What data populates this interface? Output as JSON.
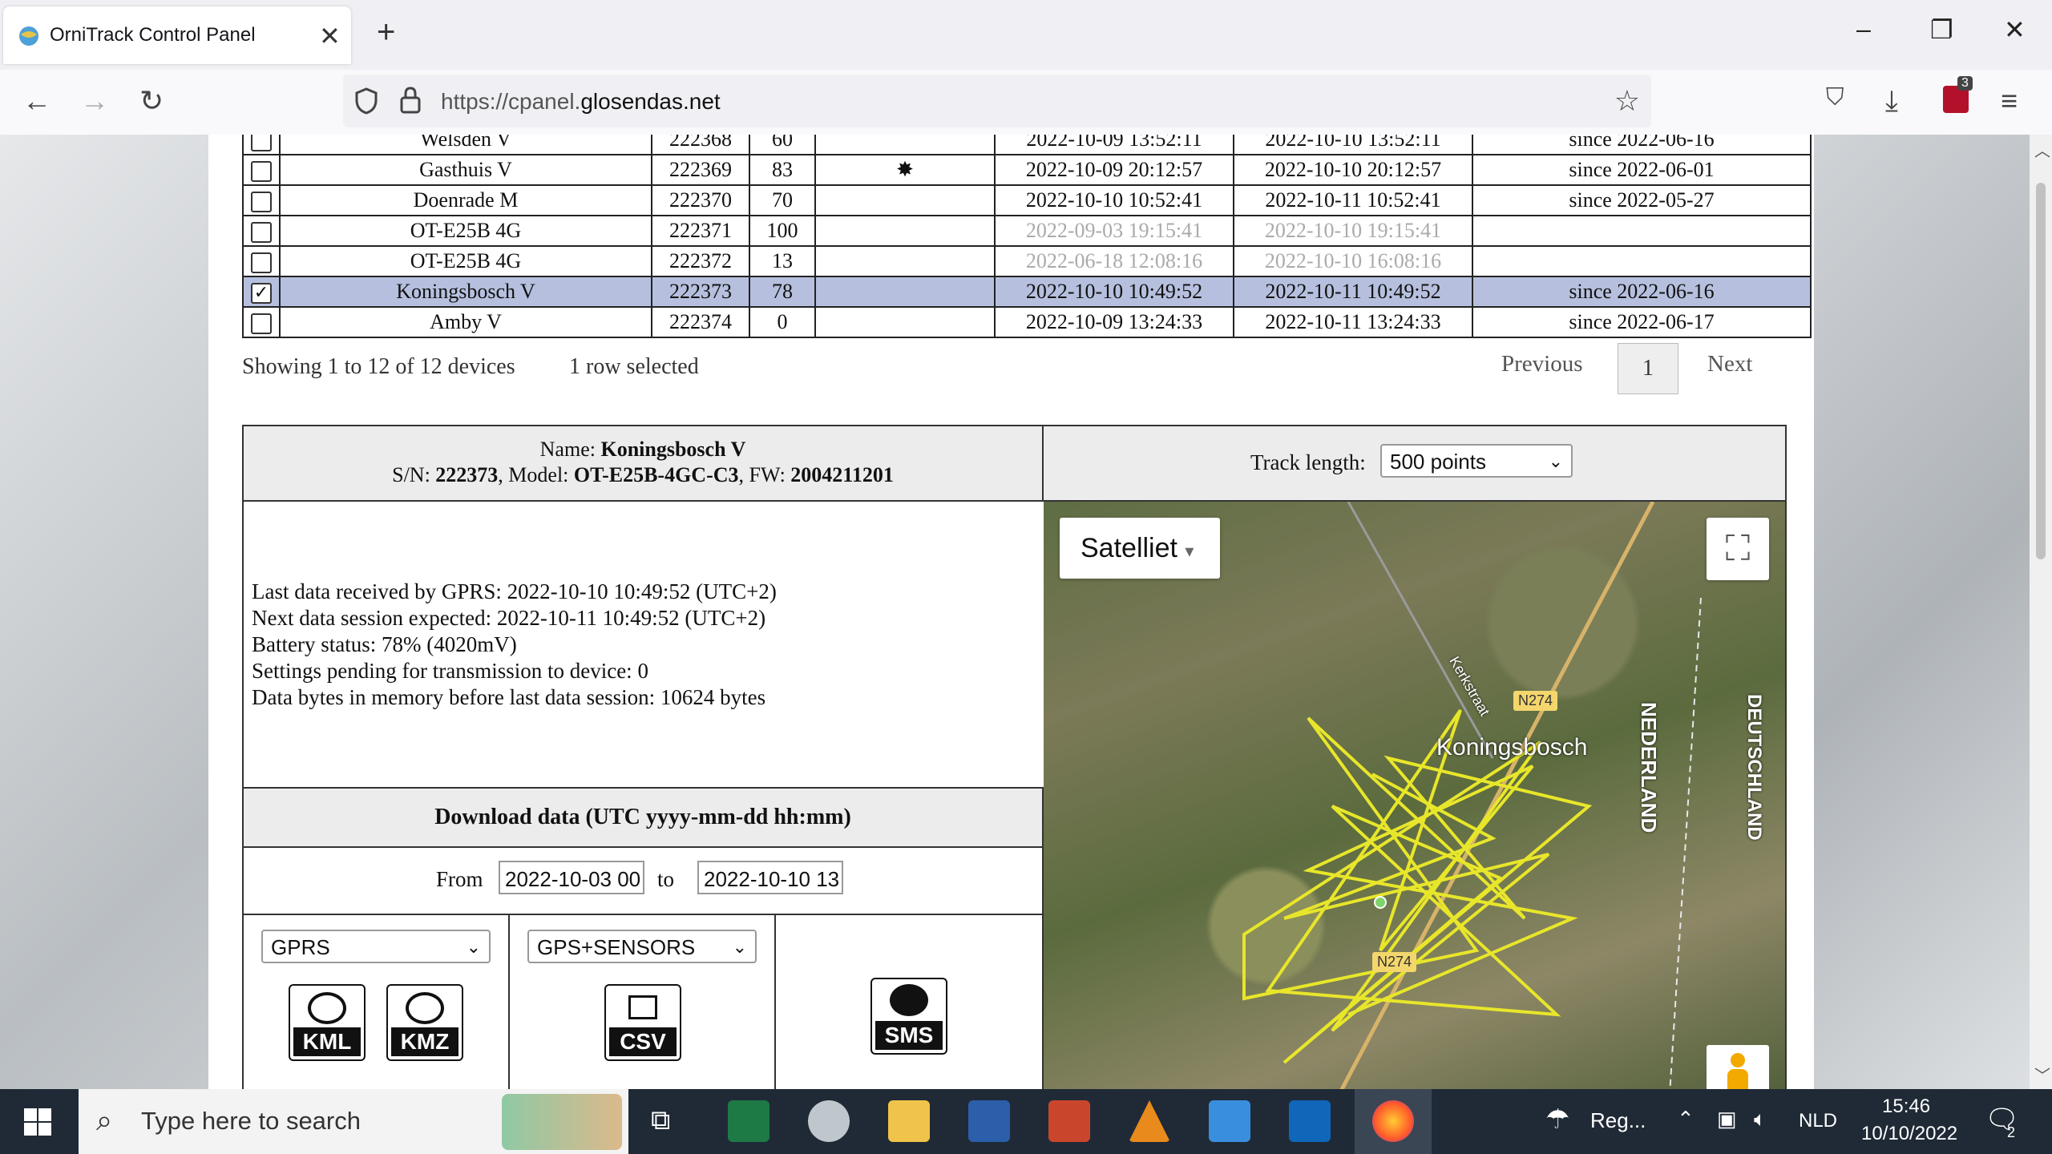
{
  "browser": {
    "tab_title": "OrniTrack Control Panel",
    "url_prefix": "https://cpanel.",
    "url_domain": "glosendas.net",
    "extension_badge": "3"
  },
  "devices_table": {
    "rows": [
      {
        "checked": false,
        "name": "Welsden V",
        "sn": "222368",
        "battery": "60",
        "flag": "",
        "last": "2022-10-09 13:52:11",
        "next": "2022-10-10 13:52:11",
        "since": "since 2022-06-16",
        "faded": false,
        "selected": false
      },
      {
        "checked": false,
        "name": "Gasthuis V",
        "sn": "222369",
        "battery": "83",
        "flag": "✸",
        "last": "2022-10-09 20:12:57",
        "next": "2022-10-10 20:12:57",
        "since": "since 2022-06-01",
        "faded": false,
        "selected": false
      },
      {
        "checked": false,
        "name": "Doenrade M",
        "sn": "222370",
        "battery": "70",
        "flag": "",
        "last": "2022-10-10 10:52:41",
        "next": "2022-10-11 10:52:41",
        "since": "since 2022-05-27",
        "faded": false,
        "selected": false
      },
      {
        "checked": false,
        "name": "OT-E25B 4G",
        "sn": "222371",
        "battery": "100",
        "flag": "",
        "last": "2022-09-03 19:15:41",
        "next": "2022-10-10 19:15:41",
        "since": "",
        "faded": true,
        "selected": false
      },
      {
        "checked": false,
        "name": "OT-E25B 4G",
        "sn": "222372",
        "battery": "13",
        "flag": "",
        "last": "2022-06-18 12:08:16",
        "next": "2022-10-10 16:08:16",
        "since": "",
        "faded": true,
        "selected": false
      },
      {
        "checked": true,
        "name": "Koningsbosch V",
        "sn": "222373",
        "battery": "78",
        "flag": "",
        "last": "2022-10-10 10:49:52",
        "next": "2022-10-11 10:49:52",
        "since": "since 2022-06-16",
        "faded": false,
        "selected": true
      },
      {
        "checked": false,
        "name": "Amby V",
        "sn": "222374",
        "battery": "0",
        "flag": "",
        "last": "2022-10-09 13:24:33",
        "next": "2022-10-11 13:24:33",
        "since": "since 2022-06-17",
        "faded": false,
        "selected": false
      }
    ],
    "showing_text": "Showing 1 to 12 of 12 devices",
    "selected_text": "1 row selected",
    "prev_label": "Previous",
    "page_label": "1",
    "next_label": "Next"
  },
  "detail": {
    "name_label": "Name: ",
    "name": "Koningsbosch V",
    "sn_label": "S/N: ",
    "sn": "222373",
    "model_label": ", Model: ",
    "model": "OT-E25B-4GC-C3",
    "fw_label": ", FW: ",
    "fw": "2004211201",
    "track_length_label": "Track length:",
    "track_length_value": "500 points",
    "status_lines": [
      "Last data received by GPRS: 2022-10-10 10:49:52 (UTC+2)",
      "Next data session expected: 2022-10-11 10:49:52 (UTC+2)",
      "Battery status: 78% (4020mV)",
      "Settings pending for transmission to device: 0",
      "Data bytes in memory before last data session: 10624 bytes"
    ],
    "download_header": "Download data (UTC yyyy-mm-dd hh:mm)",
    "from_label": "From",
    "from_value": "2022-10-03 00",
    "to_label": "to",
    "to_value": "2022-10-10 13",
    "source_select": "GPRS",
    "data_select": "GPS+SENSORS",
    "kml_label": "KML",
    "kmz_label": "KMZ",
    "csv_label": "CSV",
    "sms_label": "SMS"
  },
  "map": {
    "type_button": "Satelliet",
    "town_label": "Koningsbosch",
    "street_label": "Kerkstraat",
    "road_badge": "N274",
    "road_badge2": "N274",
    "country_nl": "NEDERLAND",
    "country_de": "DEUTSCHLAND",
    "track_color": "#e8e62a"
  },
  "taskbar": {
    "search_placeholder": "Type here to search",
    "weather": "Reg...",
    "lang": "NLD",
    "time": "15:46",
    "date": "10/10/2022",
    "notif_count": "2"
  }
}
